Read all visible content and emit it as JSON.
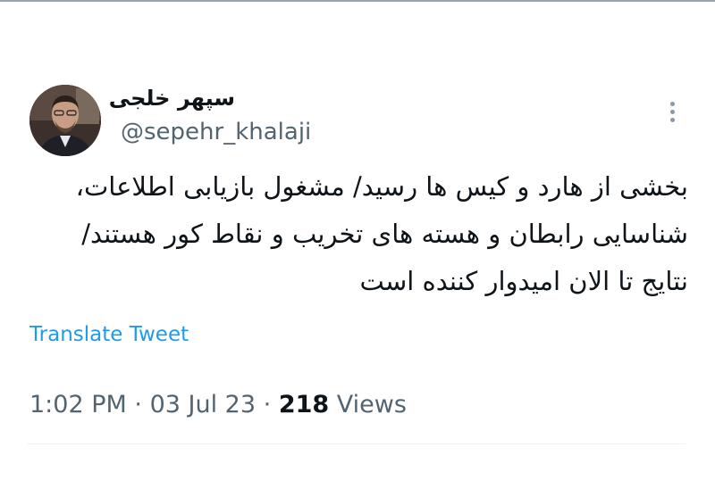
{
  "author": {
    "display_name": "سپهر خلجی",
    "handle": "@sepehr_khalaji",
    "avatar_icon": "user-avatar-photo"
  },
  "more_menu": {
    "icon": "vertical-ellipsis-icon"
  },
  "tweet": {
    "lines": [
      "بخشی از هارد و کیس ها رسید/ مشغول بازیابی اطلاعات،",
      "شناسایی رابطان و هسته های تخریب و نقاط کور هستند/",
      "نتایج تا الان امیدوار کننده است"
    ]
  },
  "translate_label": "Translate Tweet",
  "meta": {
    "time": "1:02 PM",
    "separator": "·",
    "date": "03 Jul 23",
    "views_count": "218",
    "views_label": "Views"
  },
  "colors": {
    "text": "#0f1419",
    "secondary": "#536471",
    "link": "#1d9bf0",
    "divider": "#eff3f4"
  }
}
